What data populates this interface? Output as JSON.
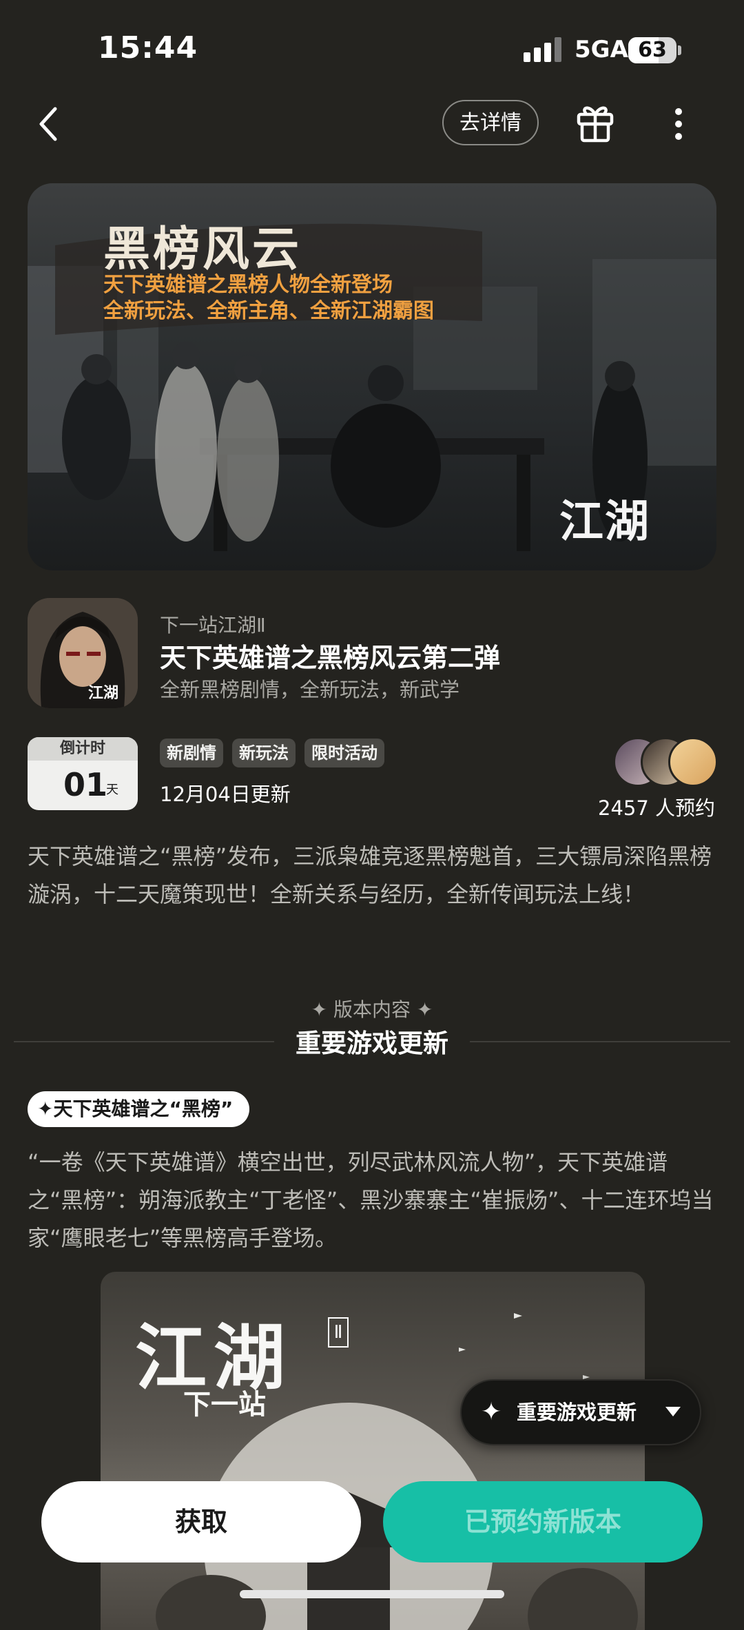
{
  "status_bar": {
    "time": "15:44",
    "network": "5GA",
    "battery": "63",
    "battery_level": 0.63
  },
  "nav": {
    "detail_label": "去详情",
    "back_icon": "chevron-left-icon",
    "gift_icon": "gift-icon",
    "more_icon": "more-vertical-icon"
  },
  "banner": {
    "title": "黑榜风云",
    "line1": "天下英雄谱之黑榜人物全新登场",
    "line2": "全新玩法、全新主角、全新江湖霸图",
    "logo": "江湖",
    "logo_sub": "下一站"
  },
  "game": {
    "name": "下一站江湖Ⅱ",
    "title": "天下英雄谱之黑榜风云第二弹",
    "desc": "全新黑榜剧情，全新玩法，新武学",
    "icon_text": "江湖"
  },
  "countdown": {
    "label": "倒计时",
    "value": "01",
    "unit": "天"
  },
  "tags": [
    "新剧情",
    "新玩法",
    "限时活动"
  ],
  "update_date": "12月04日更新",
  "reservations": {
    "count_text": "2457 人预约"
  },
  "description": "天下英雄谱之“黑榜”发布，三派枭雄竞逐黑榜魁首，三大镖局深陷黑榜漩涡，十二天魔策现世！全新关系与经历，全新传闻玩法上线！",
  "section": {
    "subtitle": "版本内容",
    "title": "重要游戏更新"
  },
  "feature": {
    "pill": "天下英雄谱之“黑榜”",
    "text": "“一卷《天下英雄谱》横空出世，列尽武林风流人物”，天下英雄谱之“黑榜”：朔海派教主“丁老怪”、黑沙寨寨主“崔振炀”、十二连环坞当家“鹰眼老七”等黑榜高手登场。"
  },
  "poster": {
    "logo": "江湖",
    "logo_sub": "下一站",
    "roman": "Ⅱ"
  },
  "float_menu": {
    "label": "重要游戏更新"
  },
  "actions": {
    "get": "获取",
    "reserved": "已预约新版本"
  },
  "colors": {
    "background": "#24231f",
    "accent": "#17bfa6",
    "banner_text": "#f0a040"
  }
}
